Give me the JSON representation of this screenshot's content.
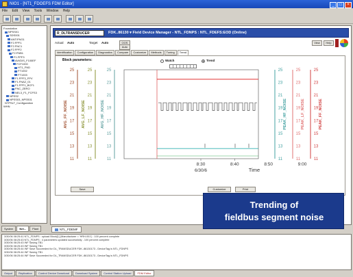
{
  "window": {
    "title": "NIO1 - [NT1_FDOEFS FDM Editor]"
  },
  "menu": {
    "items": [
      "File",
      "Edit",
      "View",
      "Tools",
      "Window",
      "Help"
    ]
  },
  "tree": {
    "items": [
      "Foundation",
      "NPSS01",
      "SDS001",
      "ANT/FNG1",
      "F2.FPF1",
      "F2.FNC1",
      "F2.FPF2",
      "F2.FNB1",
      "F1.FPF3",
      "AVI/DIS_F100EF",
      "FCF1000",
      "HT1_FND",
      "FT1002",
      "FT1003",
      "F1.FPF3_FPV",
      "F1.FNA2_01",
      "F1.FPF1_BCF1",
      "FNC_ZERO",
      "NEL3_F1_FCFS3",
      "NPSS2",
      "NPSS03_NPSS01",
      "NTPSLT_Configuration",
      "WHN"
    ],
    "tabs": [
      "System",
      "Net...",
      "Plant"
    ]
  },
  "device_bar": {
    "device": "R_DLTRANSDUCER",
    "title": "FDK..86130 ▾  Field Device Manager - NTL_FDNPS : NTL_FDEFS:EOD (Online)"
  },
  "params": {
    "actual_label": "Actual",
    "actual_value": "Auto",
    "target_label": "Target",
    "target_value": "Auto",
    "oos_button": "OOS",
    "auto_button": "Auto",
    "view_button": "View",
    "help_button": "Help"
  },
  "tabs": [
    "Identification",
    "Configuration",
    "Diagnostics",
    "Compare",
    "Customize",
    "Methods",
    "Tuning",
    "Trend"
  ],
  "trend": {
    "block_params_label": "Block parameters:",
    "watch_label": "Watch",
    "trend_label": "Trend",
    "save_button": "Save",
    "customize_button": "Customize",
    "print_button": "Print"
  },
  "doc_tab": "NTL_FDEMF",
  "log": {
    "lines": [
      "3/30/06 08:25:41 NTL_FDNPS : upload Block[1] (Manufacturer = 'HRH-001') : 100 percent complete",
      "3/30/06 08:25:43 NTL_FDNPS : 4 parameters updated successfully - 100 percent complete",
      "3/30/06 08:25:43 INF Saving TB1",
      "3/30/06 08:25:43 INF Saving TB1",
      "3/30/06 08:25:44 INF Save Succeeded for DL_TRANSDUCER FDK..86130173 - DeviceTag is NTL_FDNPS",
      "3/30/06 08:25:44 INF Saving TB1",
      "3/30/06 08:25:44 INF Save Succeeded for DL_TRANSDUCER FDK..86130173 - DeviceTag is NTL_FDNPS"
    ],
    "tabs": [
      "Output",
      "Replication",
      "Control Device Download",
      "Download System",
      "Control Station Upload",
      "FDM Editor"
    ]
  },
  "callout": {
    "line1": "Trending of",
    "line2": "fieldbus segment noise"
  },
  "colors": {
    "title_bar": "#1c4ec0",
    "fdm_bar": "#2a4ea8",
    "callout_bg": "#1b3a8c",
    "avg_ff_noise": "#a05030",
    "avg_lf_noise": "#889030",
    "avg_hf_noise": "#60a0a0",
    "peak_hf_noise": "#40a0a0",
    "peak_lf_noise": "#e07070",
    "peak_ff_noise": "#d04040",
    "trace_square": "#666666",
    "trace_red": "#e03030",
    "trace_cyan": "#30b0b0"
  },
  "chart_data": {
    "type": "line",
    "x": [
      "8:30",
      "8:40",
      "8:50",
      "9:00"
    ],
    "x_sublabel": "6/30/6",
    "xlabel": "Time",
    "axes": [
      {
        "name": "AVG_FF_NOISE",
        "ticks": [
          "25",
          "23",
          "21",
          "19",
          "17",
          "15",
          "13",
          "11"
        ]
      },
      {
        "name": "AVG_LF_NOISE",
        "ticks": [
          "25",
          "23",
          "21",
          "19",
          "17",
          "15",
          "13",
          "11"
        ]
      },
      {
        "name": "AVG_HF_NOISE",
        "ticks": [
          "25",
          "23",
          "21",
          "19",
          "17",
          "15",
          "13",
          "11"
        ]
      },
      {
        "name": "PEAK_HF_NOISE",
        "ticks": [
          "25",
          "23",
          "21",
          "19",
          "17",
          "15",
          "13",
          "11"
        ]
      },
      {
        "name": "PEAK_LF_NOISE",
        "ticks": [
          "25",
          "23",
          "21",
          "19",
          "17",
          "15",
          "13",
          "11"
        ]
      },
      {
        "name": "PEAK_FF_NOISE",
        "ticks": [
          "25",
          "23",
          "21",
          "19",
          "17",
          "15",
          "13",
          "11"
        ]
      }
    ],
    "ylim": [
      11,
      25
    ],
    "series": [
      {
        "name": "PEAK_FF_NOISE",
        "values": [
          23.5,
          23.5,
          23.5,
          23.5
        ]
      },
      {
        "name": "AVG_LF_NOISE",
        "values": [
          19.8,
          18.6,
          19.8,
          18.6
        ]
      },
      {
        "name": "AVG_HF_NOISE",
        "values": [
          12.6,
          12.6,
          12.6,
          12.6
        ]
      }
    ]
  }
}
